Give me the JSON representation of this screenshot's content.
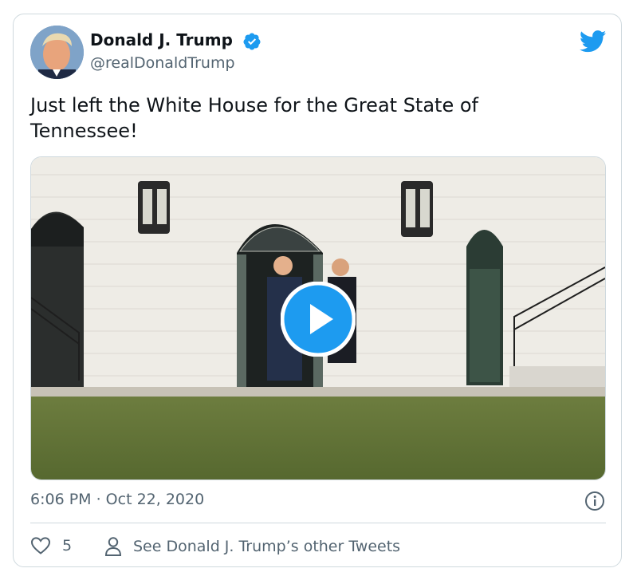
{
  "author": {
    "name": "Donald J. Trump",
    "handle": "@realDonaldTrump",
    "verified": true,
    "avatar_icon": "profile-photo"
  },
  "tweet": {
    "text": "Just left the White House for the Great State of Tennessee!",
    "media_type": "video",
    "timestamp": "6:06 PM · Oct 22, 2020"
  },
  "actions": {
    "like_count": "5",
    "other_tweets_label": "See Donald J. Trump’s other Tweets"
  },
  "colors": {
    "accent": "#1d9bf0",
    "text_primary": "#0f1419",
    "text_secondary": "#536471",
    "border": "#cfd9de"
  },
  "icons": [
    "twitter-bird-icon",
    "verified-badge-icon",
    "play-icon",
    "info-icon",
    "heart-icon",
    "person-icon"
  ]
}
